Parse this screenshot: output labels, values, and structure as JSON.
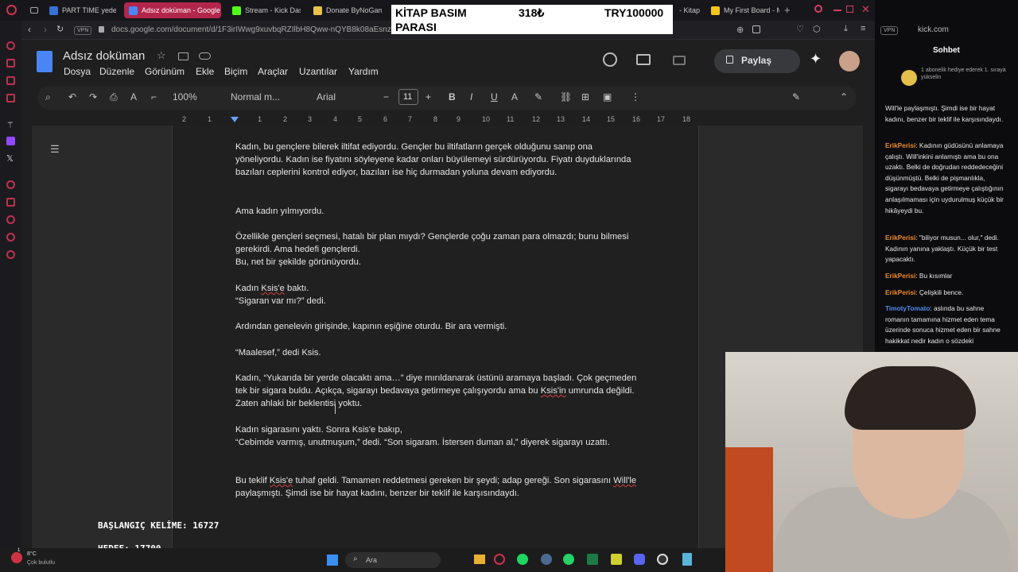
{
  "browser": {
    "tabs": [
      {
        "label": "PART TIME yedek",
        "color": "#3a6fd8"
      },
      {
        "label": "Adsız doküman - Google",
        "color": "#4a85f5"
      },
      {
        "label": "Stream - Kick Das",
        "color": "#53fc18"
      },
      {
        "label": "Donate ByNoGam",
        "color": "#e8c24a"
      },
      {
        "label": "- Kitap",
        "color": "#888888"
      },
      {
        "label": "My First Board - M",
        "color": "#f5c518"
      }
    ],
    "url": "docs.google.com/document/d/1F3irIWwg9xuvbqRZIlbH8Qww-nQYB8k08aEsnzctnPs",
    "vpn_label": "VPN"
  },
  "docs": {
    "title": "Adsız doküman",
    "menus": [
      "Dosya",
      "Düzenle",
      "Görünüm",
      "Ekle",
      "Biçim",
      "Araçlar",
      "Uzantılar",
      "Yardım"
    ],
    "share_label": "Paylaş",
    "zoom": "100%",
    "style": "Normal m...",
    "font": "Arial",
    "font_size": "11",
    "ruler_numbers": [
      "2",
      "1",
      "1",
      "2",
      "3",
      "4",
      "5",
      "6",
      "7",
      "8",
      "9",
      "10",
      "11",
      "12",
      "13",
      "14",
      "15",
      "16",
      "17",
      "18"
    ]
  },
  "document": {
    "p1": "Kadın, bu gençlere bilerek iltifat ediyordu. Gençler bu iltifatların gerçek olduğunu sanıp ona yöneliyordu. Kadın ise fiyatını söyleyene kadar onları büyülemeyi sürdürüyordu. Fiyatı duyduklarında bazıları ceplerini kontrol ediyor, bazıları ise hiç durmadan yoluna devam ediyordu.",
    "p2": "Ama kadın yılmıyordu.",
    "p3a": "Özellikle gençleri seçmesi, hatalı bir plan mıydı? Gençlerde çoğu zaman para olmazdı; bunu bilmesi gerekirdi. Ama hedefi gençlerdi.",
    "p3b": "Bu, net bir şekilde görünüyordu.",
    "p4a_pre": "Kadın ",
    "p4a_sq": "Ksis'e",
    "p4a_post": " baktı.",
    "p4b": "“Sigaran var mı?” dedi.",
    "p5": "Ardından genelevin girişinde, kapının eşiğine oturdu. Bir ara vermişti.",
    "p6": "“Maalesef,” dedi Ksis.",
    "p7a": "Kadın, “Yukarıda bir yerde olacaktı ama…” diye mırıldanarak üstünü aramaya başladı. Çok geçmeden tek bir sigara buldu. Açıkça, sigarayı bedavaya getirmeye çalışıyordu ama bu ",
    "p7_sq": "Ksis'in",
    "p7b": " umrunda değildi. Zaten ahlaki bir beklentisi yoktu.",
    "p8a": "Kadın sigarasını yaktı. Sonra Ksis'e bakıp,",
    "p8b": "“Cebimde varmış, unutmuşum,” dedi. “Son sigaram. İstersen duman al,” diyerek sigarayı uzattı.",
    "p9_pre": "Bu teklif ",
    "p9_sq1": "Ksis'e",
    "p9_mid": " tuhaf geldi. Tamamen reddetmesi gereken bir şeydi; adap gereği. Son sigarasını ",
    "p9_sq2": "Will'le",
    "p9_post": " paylaşmıştı. Şimdi ise bir hayat kadını, benzer bir teklif ile karşısındaydı."
  },
  "overlay": {
    "label_line1": "KİTAP BASIM",
    "label_line2": "PARASI",
    "price": "318₺",
    "total": "TRY100000"
  },
  "stream_counters": {
    "start_words": "BAŞLANGIÇ KELİME: 16727",
    "target": "HEDEF: 17700"
  },
  "chat": {
    "title": "Sohbet",
    "sub_banner": "1 abonelik hediye ederek 1. sıraya yükselin",
    "messages": [
      {
        "user": "",
        "text": "Will'le paylaşmıştı. Şimdi ise bir hayat kadını, benzer bir teklif ile karşısındaydı."
      },
      {
        "user": "ErikPerisi",
        "text": ": Kadının güdüsünü anlamaya çalıştı. Will'inkini anlamıştı ama bu ona uzaktı. Belki de doğrudan reddedeceğini düşünmüştü. Belki de pişmanlıkla, sigarayı bedavaya getirmeye çalıştığının anlaşılmaması için uydurulmuş küçük bir hikâyeydi bu."
      },
      {
        "user": "ErikPerisi",
        "text": ": \"biliyor musun... olur,\" dedi. Kadının yanına yaklaştı. Küçük bir test yapacaktı."
      },
      {
        "user": "ErikPerisi",
        "text": ": Bu kısımlar"
      },
      {
        "user": "ErikPerisi",
        "text": ": Çelişkili bence."
      },
      {
        "user": "TimotyTomato",
        "text": ": aslında bu sahne romanın tamamına hizmet eden tema üzerinde sonuca hizmet eden bir sahne hakikkat nedir kadın o sözdeki"
      }
    ]
  },
  "taskbar": {
    "weather_temp": "8°C",
    "weather_desc": "Çok bulutlu",
    "search": "Ara",
    "notif_badge": "1"
  }
}
